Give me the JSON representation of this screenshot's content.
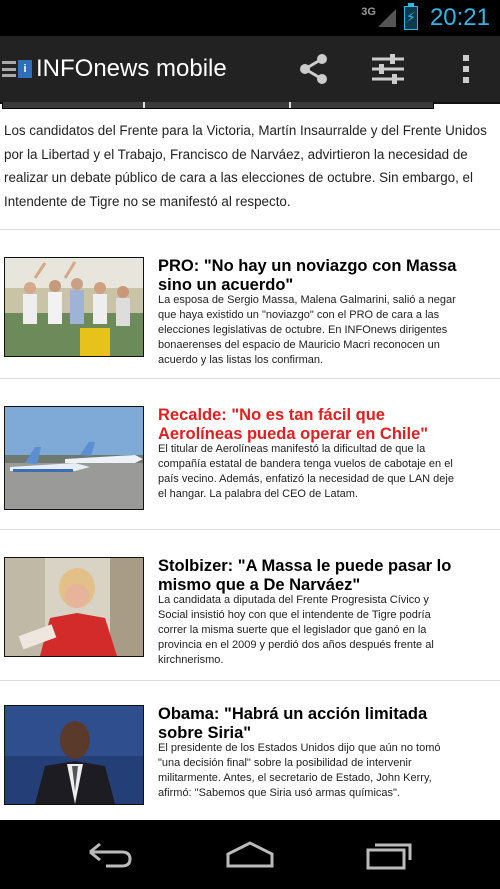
{
  "status": {
    "network": "3G",
    "time": "20:21"
  },
  "app": {
    "logo_text": "i",
    "title": "INFOnews mobile"
  },
  "actions": [
    "share-icon",
    "settings-sliders-icon",
    "overflow-menu-icon"
  ],
  "lead_text": "Los candidatos del Frente para la Victoria, Martín Insaurralde y del Frente Unidos por la Libertad y el Trabajo, Francisco de Narváez, advirtieron la necesidad de realizar un debate público de cara a las elecciones de octubre. Sin embargo, el Intendente de Tigre no se manifestó al respecto.",
  "articles": [
    {
      "title": "PRO: \"No hay un noviazgo con Massa sino un acuerdo\"",
      "summary": "La esposa de Sergio Massa, Malena Galmarini, salió a negar que haya existido un \"noviazgo\" con el PRO de cara a las elecciones legislativas de octubre. En INFOnews dirigentes bonaerenses del espacio de Mauricio Macri reconocen un acuerdo y las listas los confirman.",
      "highlight": false
    },
    {
      "title": "Recalde: \"No es tan fácil que Aerolíneas pueda operar en Chile\"",
      "summary": "El titular de Aerolíneas manifestó la dificultad de que la compañía estatal de bandera tenga vuelos de cabotaje en el país vecino. Además, enfatizó la necesidad de que LAN deje el hangar. La palabra del CEO de Latam.",
      "highlight": true
    },
    {
      "title": "Stolbizer: \"A Massa le puede pasar lo mismo que a De Narváez\"",
      "summary": "La candidata a diputada del Frente Progresista Cívico y Social insistió hoy con que el intendente de Tigre podría correr la misma suerte que el legislador que ganó en la provincia en el 2009 y perdió dos años después frente al kirchnerismo.",
      "highlight": false
    },
    {
      "title": "Obama: \"Habrá un acción limitada sobre Siria\"",
      "summary": "El presidente de los Estados Unidos dijo que aún no tomó \"una decisión final\" sobre la posibilidad de intervenir militarmente. Antes, el secretario de Estado, John Kerry, afirmó: \"Sabemos que Siria usó armas químicas\".",
      "highlight": false
    }
  ],
  "colors": {
    "status_accent": "#33b5e5",
    "highlight_title": "#e02020",
    "actionbar": "#222222"
  },
  "nav": [
    "back-icon",
    "home-icon",
    "recent-apps-icon"
  ]
}
